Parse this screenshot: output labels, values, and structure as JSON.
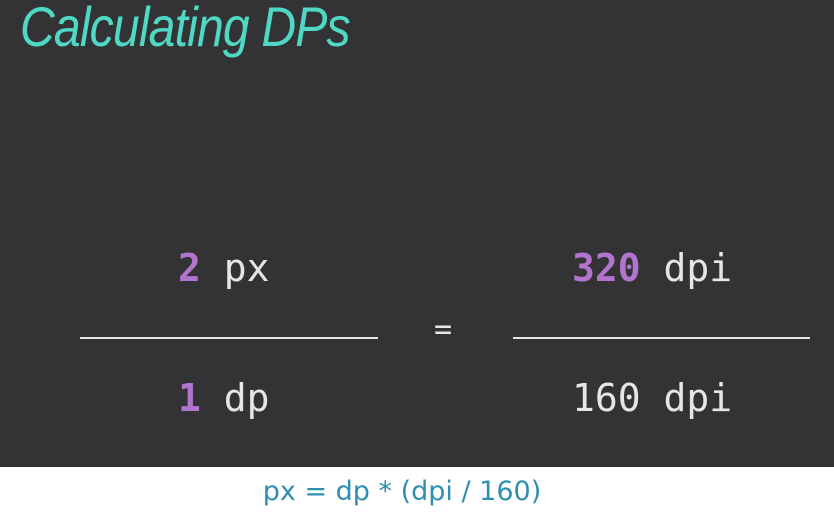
{
  "slide": {
    "title": "Calculating DPs",
    "left_fraction": {
      "numerator_value": "2",
      "numerator_unit": " px",
      "denominator_value": "1",
      "denominator_unit": " dp"
    },
    "equals": "=",
    "right_fraction": {
      "numerator_value": "320",
      "numerator_unit": " dpi",
      "denominator": "160 dpi"
    }
  },
  "caption": "px = dp * (dpi / 160)",
  "colors": {
    "title": "#4fd8c4",
    "highlight": "#b274cf",
    "text": "#e6e6e6",
    "background": "#333335",
    "caption": "#2f8fb0"
  }
}
